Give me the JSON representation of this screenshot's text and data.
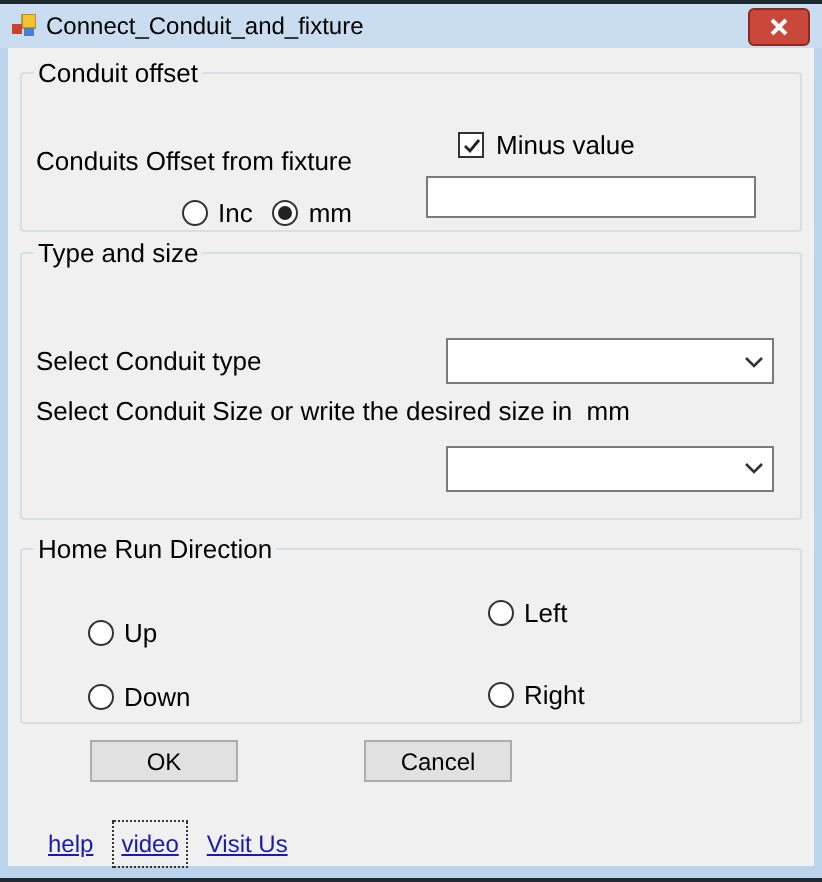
{
  "window": {
    "title": "Connect_Conduit_and_fixture"
  },
  "conduit_offset": {
    "legend": "Conduit offset",
    "label": "Conduits Offset from fixture",
    "minus_value": {
      "label": "Minus value",
      "checked": true
    },
    "units": [
      {
        "label": "Inc",
        "selected": false
      },
      {
        "label": "mm",
        "selected": true
      }
    ]
  },
  "type_and_size": {
    "legend": "Type and size",
    "type_label": "Select Conduit type",
    "size_label": "Select Conduit Size or write the desired size in  mm"
  },
  "home_run_direction": {
    "legend": "Home Run Direction",
    "options": [
      {
        "label": "Up",
        "selected": false
      },
      {
        "label": "Down",
        "selected": false
      },
      {
        "label": "Left",
        "selected": false
      },
      {
        "label": "Right",
        "selected": false
      }
    ]
  },
  "buttons": [
    "OK",
    "Cancel"
  ],
  "links": [
    {
      "label": "help",
      "focused": false
    },
    {
      "label": "video",
      "focused": true
    },
    {
      "label": "Visit Us",
      "focused": false
    }
  ]
}
